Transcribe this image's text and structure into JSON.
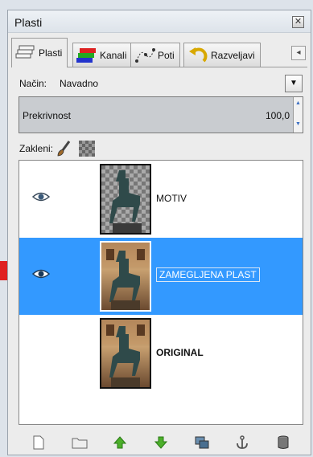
{
  "window": {
    "title": "Plasti",
    "close_symbol": "✕"
  },
  "tabs": [
    {
      "label": "Plasti",
      "icon": "layers-icon"
    },
    {
      "label": "Kanali",
      "icon": "channels-icon"
    },
    {
      "label": "Poti",
      "icon": "paths-icon"
    },
    {
      "label": "Razveljavi",
      "icon": "undo-icon"
    }
  ],
  "tab_scroll_symbol": "◂",
  "mode": {
    "label": "Način:",
    "value": "Navadno",
    "dropdown_symbol": "▼"
  },
  "opacity": {
    "label": "Prekrivnost",
    "value": "100,0",
    "up": "▲",
    "down": "▼"
  },
  "lock": {
    "label": "Zakleni:"
  },
  "layers": [
    {
      "name": "MOTIV",
      "visible": true,
      "selected": false
    },
    {
      "name": "ZAMEGLJENA PLAST",
      "visible": true,
      "selected": true
    },
    {
      "name": "ORIGINAL",
      "visible": false,
      "selected": false
    }
  ],
  "toolbar_buttons": [
    "new-layer-icon",
    "new-layer-group-icon",
    "raise-layer-icon",
    "lower-layer-icon",
    "duplicate-layer-icon",
    "anchor-layer-icon",
    "delete-layer-icon"
  ],
  "colors": {
    "selection": "#3399ff",
    "pointer_arrow": "#e02020"
  }
}
